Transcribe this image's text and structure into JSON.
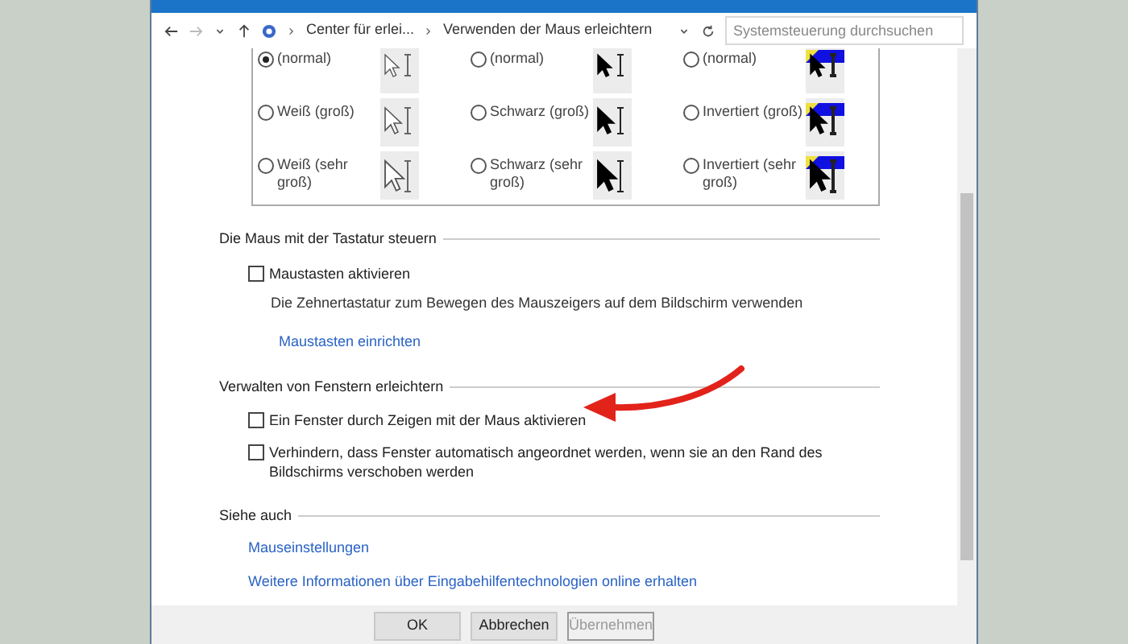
{
  "nav": {
    "breadcrumb": [
      "Center für erlei...",
      "Verwenden der Maus erleichtern"
    ],
    "search": {
      "placeholder": "Systemsteuerung durchsuchen"
    }
  },
  "cursor_schemes": [
    {
      "label": "(normal)",
      "selected": true,
      "kind": "white"
    },
    {
      "label": "(normal)",
      "selected": false,
      "kind": "black"
    },
    {
      "label": "(normal)",
      "selected": false,
      "kind": "inverted"
    },
    {
      "label": "Weiß (groß)",
      "selected": false,
      "kind": "white"
    },
    {
      "label": "Schwarz (groß)",
      "selected": false,
      "kind": "black"
    },
    {
      "label": "Invertiert (groß)",
      "selected": false,
      "kind": "inverted"
    },
    {
      "label": "Weiß (sehr groß)",
      "selected": false,
      "kind": "white"
    },
    {
      "label": "Schwarz (sehr groß)",
      "selected": false,
      "kind": "black"
    },
    {
      "label": "Invertiert (sehr groß)",
      "selected": false,
      "kind": "inverted"
    }
  ],
  "sections": [
    {
      "title": "Die Maus mit der Tastatur steuern",
      "items": [
        {
          "kind": "checkbox",
          "label": "Maustasten aktivieren",
          "checked": false
        },
        {
          "kind": "text",
          "text": "Die Zehnertastatur zum Bewegen des Mauszeigers auf dem Bildschirm verwenden"
        },
        {
          "kind": "link",
          "text": "Maustasten einrichten"
        }
      ]
    },
    {
      "title": "Verwalten von Fenstern erleichtern",
      "items": [
        {
          "kind": "checkbox",
          "label": "Ein Fenster durch Zeigen mit der Maus aktivieren",
          "checked": false
        },
        {
          "kind": "checkbox",
          "label": "Verhindern, dass Fenster automatisch angeordnet werden, wenn sie an den Rand des Bildschirms verschoben werden",
          "checked": false
        }
      ]
    },
    {
      "title": "Siehe auch",
      "items": [
        {
          "kind": "seelink",
          "text": "Mauseinstellungen"
        },
        {
          "kind": "seelink",
          "text": "Weitere Informationen über Eingabehilfentechnologien online erhalten"
        }
      ]
    }
  ],
  "buttons": [
    {
      "label": "OK",
      "disabled": false
    },
    {
      "label": "Abbrechen",
      "disabled": false
    },
    {
      "label": "Übernehmen",
      "disabled": true
    }
  ]
}
